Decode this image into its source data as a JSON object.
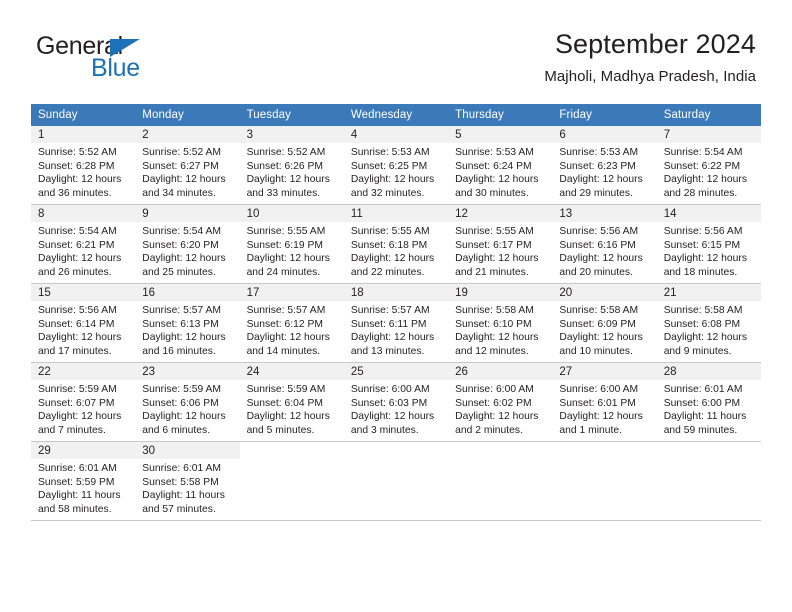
{
  "brand": {
    "name_top": "General",
    "name_bottom": "Blue",
    "triangle_color": "#1b72b8",
    "text_color": "#231f20"
  },
  "header": {
    "title": "September 2024",
    "subtitle": "Majholi, Madhya Pradesh, India"
  },
  "theme": {
    "header_row_bg": "#3b79b9",
    "header_row_text": "#ffffff",
    "daynum_band_bg": "#f1f1f1",
    "grid_line": "#c8c8c8",
    "body_text": "#231f20",
    "page_bg": "#ffffff"
  },
  "weekdays": [
    "Sunday",
    "Monday",
    "Tuesday",
    "Wednesday",
    "Thursday",
    "Friday",
    "Saturday"
  ],
  "weeks": [
    [
      {
        "day": "1",
        "sunrise": "Sunrise: 5:52 AM",
        "sunset": "Sunset: 6:28 PM",
        "daylight1": "Daylight: 12 hours",
        "daylight2": "and 36 minutes."
      },
      {
        "day": "2",
        "sunrise": "Sunrise: 5:52 AM",
        "sunset": "Sunset: 6:27 PM",
        "daylight1": "Daylight: 12 hours",
        "daylight2": "and 34 minutes."
      },
      {
        "day": "3",
        "sunrise": "Sunrise: 5:52 AM",
        "sunset": "Sunset: 6:26 PM",
        "daylight1": "Daylight: 12 hours",
        "daylight2": "and 33 minutes."
      },
      {
        "day": "4",
        "sunrise": "Sunrise: 5:53 AM",
        "sunset": "Sunset: 6:25 PM",
        "daylight1": "Daylight: 12 hours",
        "daylight2": "and 32 minutes."
      },
      {
        "day": "5",
        "sunrise": "Sunrise: 5:53 AM",
        "sunset": "Sunset: 6:24 PM",
        "daylight1": "Daylight: 12 hours",
        "daylight2": "and 30 minutes."
      },
      {
        "day": "6",
        "sunrise": "Sunrise: 5:53 AM",
        "sunset": "Sunset: 6:23 PM",
        "daylight1": "Daylight: 12 hours",
        "daylight2": "and 29 minutes."
      },
      {
        "day": "7",
        "sunrise": "Sunrise: 5:54 AM",
        "sunset": "Sunset: 6:22 PM",
        "daylight1": "Daylight: 12 hours",
        "daylight2": "and 28 minutes."
      }
    ],
    [
      {
        "day": "8",
        "sunrise": "Sunrise: 5:54 AM",
        "sunset": "Sunset: 6:21 PM",
        "daylight1": "Daylight: 12 hours",
        "daylight2": "and 26 minutes."
      },
      {
        "day": "9",
        "sunrise": "Sunrise: 5:54 AM",
        "sunset": "Sunset: 6:20 PM",
        "daylight1": "Daylight: 12 hours",
        "daylight2": "and 25 minutes."
      },
      {
        "day": "10",
        "sunrise": "Sunrise: 5:55 AM",
        "sunset": "Sunset: 6:19 PM",
        "daylight1": "Daylight: 12 hours",
        "daylight2": "and 24 minutes."
      },
      {
        "day": "11",
        "sunrise": "Sunrise: 5:55 AM",
        "sunset": "Sunset: 6:18 PM",
        "daylight1": "Daylight: 12 hours",
        "daylight2": "and 22 minutes."
      },
      {
        "day": "12",
        "sunrise": "Sunrise: 5:55 AM",
        "sunset": "Sunset: 6:17 PM",
        "daylight1": "Daylight: 12 hours",
        "daylight2": "and 21 minutes."
      },
      {
        "day": "13",
        "sunrise": "Sunrise: 5:56 AM",
        "sunset": "Sunset: 6:16 PM",
        "daylight1": "Daylight: 12 hours",
        "daylight2": "and 20 minutes."
      },
      {
        "day": "14",
        "sunrise": "Sunrise: 5:56 AM",
        "sunset": "Sunset: 6:15 PM",
        "daylight1": "Daylight: 12 hours",
        "daylight2": "and 18 minutes."
      }
    ],
    [
      {
        "day": "15",
        "sunrise": "Sunrise: 5:56 AM",
        "sunset": "Sunset: 6:14 PM",
        "daylight1": "Daylight: 12 hours",
        "daylight2": "and 17 minutes."
      },
      {
        "day": "16",
        "sunrise": "Sunrise: 5:57 AM",
        "sunset": "Sunset: 6:13 PM",
        "daylight1": "Daylight: 12 hours",
        "daylight2": "and 16 minutes."
      },
      {
        "day": "17",
        "sunrise": "Sunrise: 5:57 AM",
        "sunset": "Sunset: 6:12 PM",
        "daylight1": "Daylight: 12 hours",
        "daylight2": "and 14 minutes."
      },
      {
        "day": "18",
        "sunrise": "Sunrise: 5:57 AM",
        "sunset": "Sunset: 6:11 PM",
        "daylight1": "Daylight: 12 hours",
        "daylight2": "and 13 minutes."
      },
      {
        "day": "19",
        "sunrise": "Sunrise: 5:58 AM",
        "sunset": "Sunset: 6:10 PM",
        "daylight1": "Daylight: 12 hours",
        "daylight2": "and 12 minutes."
      },
      {
        "day": "20",
        "sunrise": "Sunrise: 5:58 AM",
        "sunset": "Sunset: 6:09 PM",
        "daylight1": "Daylight: 12 hours",
        "daylight2": "and 10 minutes."
      },
      {
        "day": "21",
        "sunrise": "Sunrise: 5:58 AM",
        "sunset": "Sunset: 6:08 PM",
        "daylight1": "Daylight: 12 hours",
        "daylight2": "and 9 minutes."
      }
    ],
    [
      {
        "day": "22",
        "sunrise": "Sunrise: 5:59 AM",
        "sunset": "Sunset: 6:07 PM",
        "daylight1": "Daylight: 12 hours",
        "daylight2": "and 7 minutes."
      },
      {
        "day": "23",
        "sunrise": "Sunrise: 5:59 AM",
        "sunset": "Sunset: 6:06 PM",
        "daylight1": "Daylight: 12 hours",
        "daylight2": "and 6 minutes."
      },
      {
        "day": "24",
        "sunrise": "Sunrise: 5:59 AM",
        "sunset": "Sunset: 6:04 PM",
        "daylight1": "Daylight: 12 hours",
        "daylight2": "and 5 minutes."
      },
      {
        "day": "25",
        "sunrise": "Sunrise: 6:00 AM",
        "sunset": "Sunset: 6:03 PM",
        "daylight1": "Daylight: 12 hours",
        "daylight2": "and 3 minutes."
      },
      {
        "day": "26",
        "sunrise": "Sunrise: 6:00 AM",
        "sunset": "Sunset: 6:02 PM",
        "daylight1": "Daylight: 12 hours",
        "daylight2": "and 2 minutes."
      },
      {
        "day": "27",
        "sunrise": "Sunrise: 6:00 AM",
        "sunset": "Sunset: 6:01 PM",
        "daylight1": "Daylight: 12 hours",
        "daylight2": "and 1 minute."
      },
      {
        "day": "28",
        "sunrise": "Sunrise: 6:01 AM",
        "sunset": "Sunset: 6:00 PM",
        "daylight1": "Daylight: 11 hours",
        "daylight2": "and 59 minutes."
      }
    ],
    [
      {
        "day": "29",
        "sunrise": "Sunrise: 6:01 AM",
        "sunset": "Sunset: 5:59 PM",
        "daylight1": "Daylight: 11 hours",
        "daylight2": "and 58 minutes."
      },
      {
        "day": "30",
        "sunrise": "Sunrise: 6:01 AM",
        "sunset": "Sunset: 5:58 PM",
        "daylight1": "Daylight: 11 hours",
        "daylight2": "and 57 minutes."
      },
      {
        "day": "",
        "sunrise": "",
        "sunset": "",
        "daylight1": "",
        "daylight2": ""
      },
      {
        "day": "",
        "sunrise": "",
        "sunset": "",
        "daylight1": "",
        "daylight2": ""
      },
      {
        "day": "",
        "sunrise": "",
        "sunset": "",
        "daylight1": "",
        "daylight2": ""
      },
      {
        "day": "",
        "sunrise": "",
        "sunset": "",
        "daylight1": "",
        "daylight2": ""
      },
      {
        "day": "",
        "sunrise": "",
        "sunset": "",
        "daylight1": "",
        "daylight2": ""
      }
    ]
  ]
}
